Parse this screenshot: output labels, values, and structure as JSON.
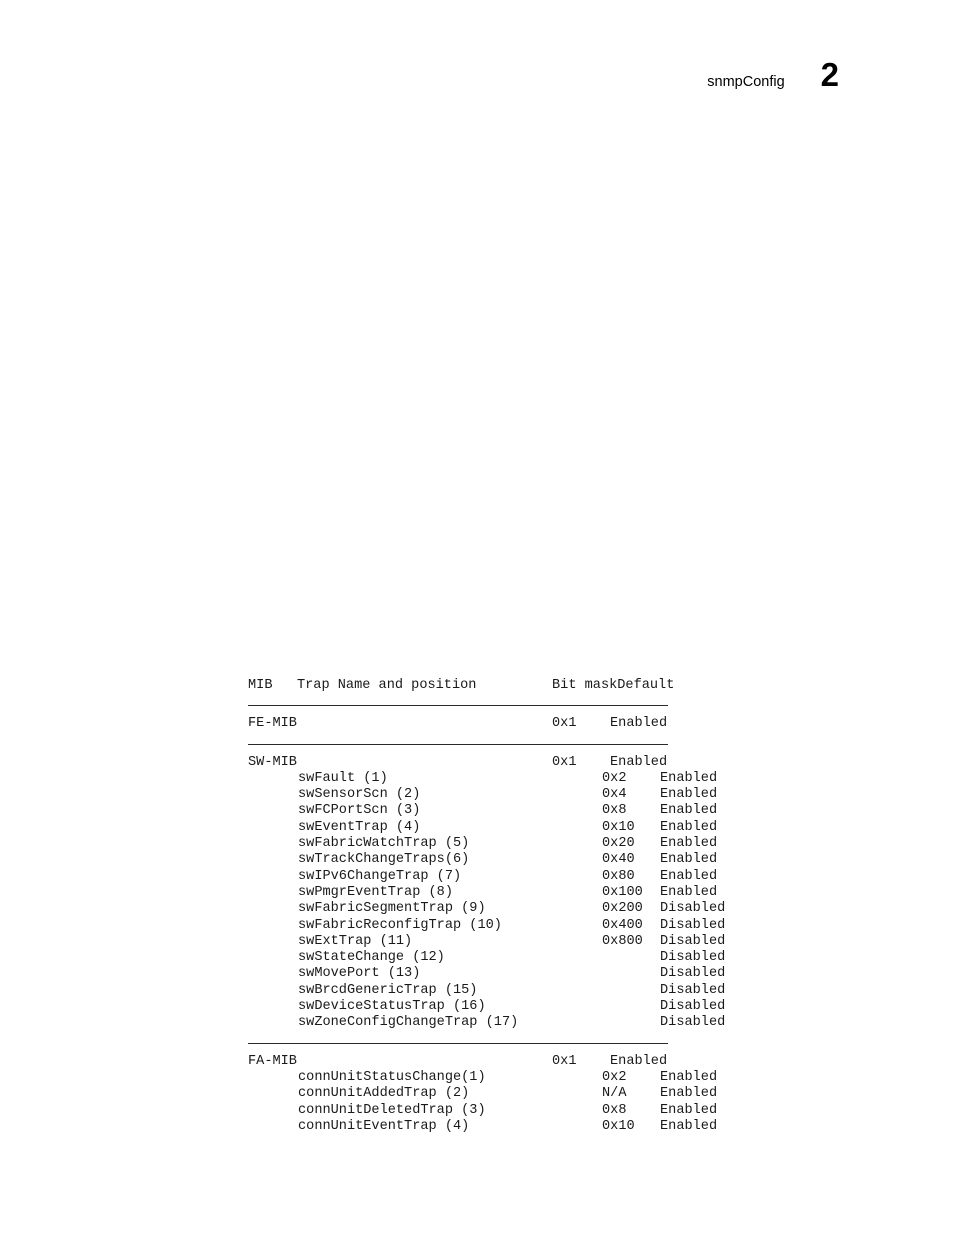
{
  "page": {
    "running_head": "snmpConfig",
    "folio": "2"
  },
  "table": {
    "columns": {
      "mib": "MIB",
      "trap_name": "Trap Name and position",
      "bit_mask": "Bit mask",
      "default": "Default"
    },
    "sections": [
      {
        "id": "fe-mib",
        "header": {
          "name": "FE-MIB",
          "mask": "0x1",
          "default": "Enabled"
        },
        "rows": []
      },
      {
        "id": "sw-mib",
        "header": {
          "name": "SW-MIB",
          "mask": "0x1",
          "default": "Enabled"
        },
        "rows": [
          {
            "name": "swFault (1)",
            "mask": "0x2",
            "default": "Enabled"
          },
          {
            "name": "swSensorScn (2)",
            "mask": "0x4",
            "default": "Enabled"
          },
          {
            "name": "swFCPortScn (3)",
            "mask": "0x8",
            "default": "Enabled"
          },
          {
            "name": "swEventTrap (4)",
            "mask": "0x10",
            "default": "Enabled"
          },
          {
            "name": "swFabricWatchTrap (5)",
            "mask": "0x20",
            "default": "Enabled"
          },
          {
            "name": "swTrackChangeTraps(6)",
            "mask": "0x40",
            "default": "Enabled"
          },
          {
            "name": "swIPv6ChangeTrap (7)",
            "mask": "0x80",
            "default": "Enabled"
          },
          {
            "name": "swPmgrEventTrap (8)",
            "mask": "0x100",
            "default": "Enabled"
          },
          {
            "name": "swFabricSegmentTrap (9)",
            "mask": "0x200",
            "default": "Disabled"
          },
          {
            "name": "swFabricReconfigTrap (10)",
            "mask": "0x400",
            "default": "Disabled"
          },
          {
            "name": "swExtTrap (11)",
            "mask": "0x800",
            "default": "Disabled"
          },
          {
            "name": "swStateChange (12)",
            "mask": "",
            "default": "Disabled"
          },
          {
            "name": "swMovePort (13)",
            "mask": "",
            "default": "Disabled"
          },
          {
            "name": "swBrcdGenericTrap (15)",
            "mask": "",
            "default": "Disabled"
          },
          {
            "name": "swDeviceStatusTrap (16)",
            "mask": "",
            "default": "Disabled"
          },
          {
            "name": "swZoneConfigChangeTrap (17)",
            "mask": "",
            "default": "Disabled"
          }
        ]
      },
      {
        "id": "fa-mib",
        "header": {
          "name": "FA-MIB",
          "mask": "0x1",
          "default": "Enabled"
        },
        "rows": [
          {
            "name": "connUnitStatusChange(1)",
            "mask": "0x2",
            "default": "Enabled"
          },
          {
            "name": "connUnitAddedTrap (2)",
            "mask": "N/A",
            "default": "Enabled"
          },
          {
            "name": "connUnitDeletedTrap (3)",
            "mask": "0x8",
            "default": "Enabled"
          },
          {
            "name": "connUnitEventTrap (4)",
            "mask": "0x10",
            "default": "Enabled"
          }
        ]
      }
    ]
  }
}
